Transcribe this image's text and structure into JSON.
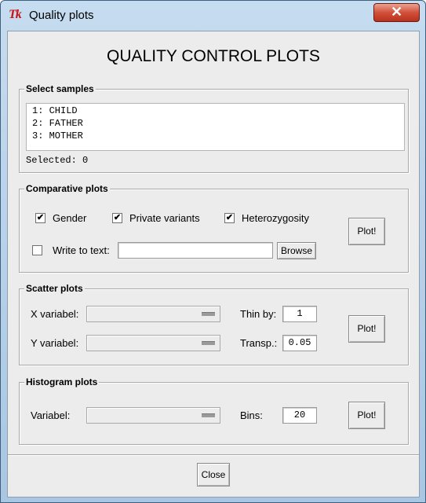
{
  "window": {
    "title": "Quality plots",
    "app_icon": "tk-feather-icon"
  },
  "heading": "QUALITY CONTROL PLOTS",
  "select_samples": {
    "legend": "Select samples",
    "items": [
      "1: CHILD",
      "2: FATHER",
      "3: MOTHER"
    ],
    "selected_text": "Selected: 0"
  },
  "comparative": {
    "legend": "Comparative plots",
    "gender_label": "Gender",
    "gender_checked": true,
    "gender_mark": "✔",
    "private_label": "Private variants",
    "private_checked": true,
    "private_mark": "✔",
    "het_label": "Heterozygosity",
    "het_checked": true,
    "het_mark": "✔",
    "write_label": "Write to text:",
    "write_checked": false,
    "write_value": "",
    "browse_label": "Browse",
    "plot_label": "Plot!"
  },
  "scatter": {
    "legend": "Scatter plots",
    "x_label": "X variabel:",
    "x_value": "",
    "y_label": "Y variabel:",
    "y_value": "",
    "thin_label": "Thin by:",
    "thin_value": "1",
    "transp_label": "Transp.:",
    "transp_value": "0.05",
    "plot_label": "Plot!"
  },
  "histogram": {
    "legend": "Histogram plots",
    "var_label": "Variabel:",
    "var_value": "",
    "bins_label": "Bins:",
    "bins_value": "20",
    "plot_label": "Plot!"
  },
  "close_label": "Close",
  "titlebar_close_glyph": "✕"
}
